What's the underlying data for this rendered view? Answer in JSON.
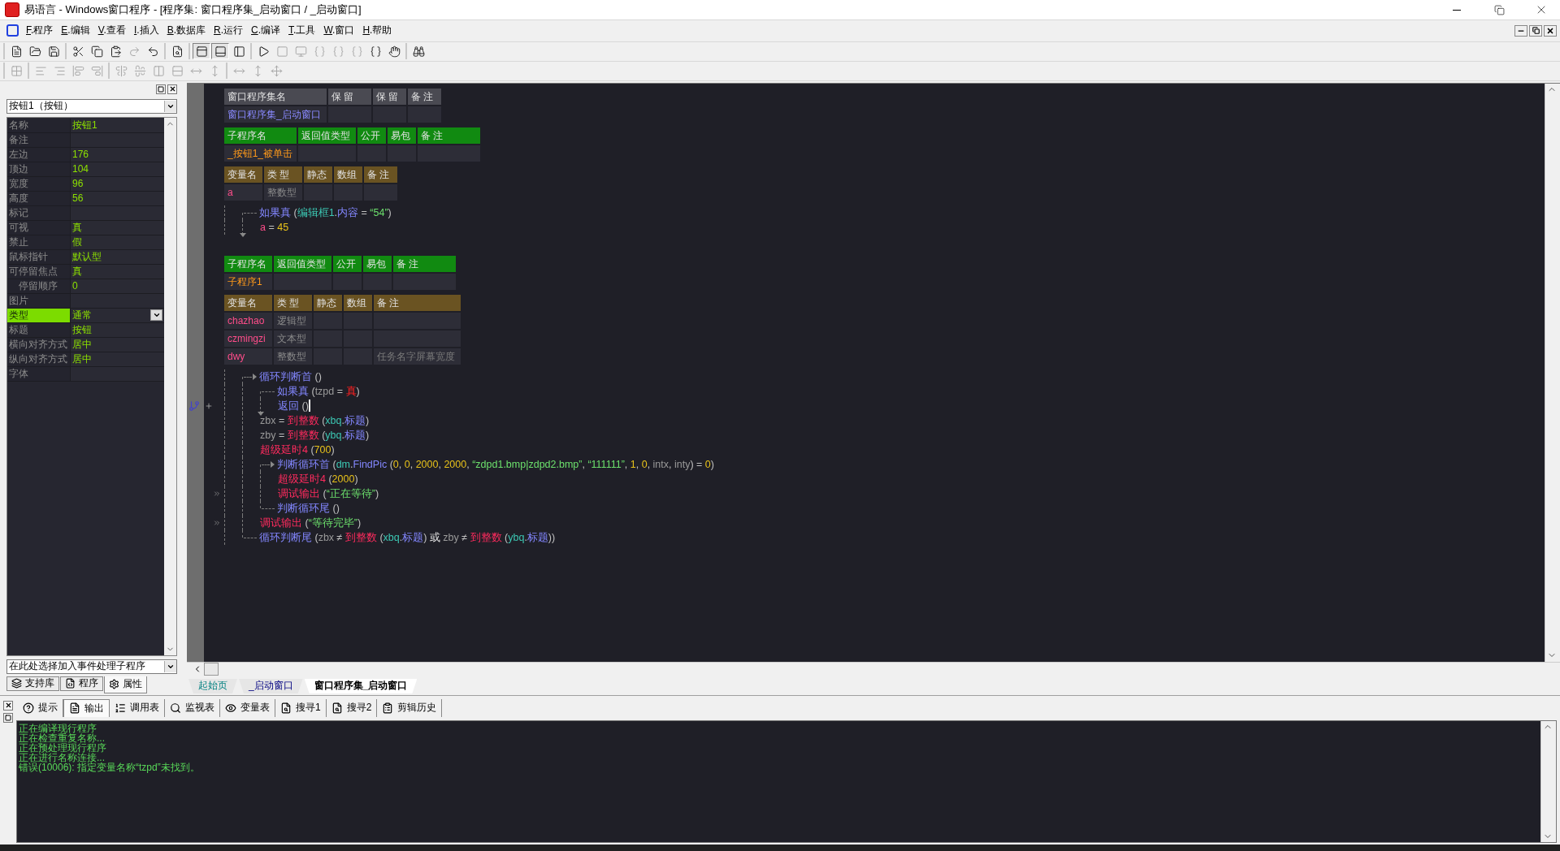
{
  "window": {
    "title": "易语言 - Windows窗口程序 - [程序集: 窗口程序集_启动窗口 / _启动窗口]"
  },
  "menu": [
    "F.程序",
    "E.编辑",
    "V.查看",
    "I.插入",
    "B.数据库",
    "R.运行",
    "C.编译",
    "T.工具",
    "W.窗口",
    "H.帮助"
  ],
  "toolbars": [
    [
      {
        "kind": "new",
        "disabled": false,
        "pressed": false
      },
      {
        "kind": "open",
        "disabled": false,
        "pressed": false
      },
      {
        "kind": "save",
        "disabled": false,
        "pressed": false
      },
      {
        "kind": "sep"
      },
      {
        "kind": "cut",
        "disabled": false,
        "pressed": false
      },
      {
        "kind": "copy",
        "disabled": false,
        "pressed": false
      },
      {
        "kind": "paste",
        "disabled": false,
        "pressed": false
      },
      {
        "kind": "redo",
        "disabled": true,
        "pressed": false
      },
      {
        "kind": "undo",
        "disabled": false,
        "pressed": false
      },
      {
        "kind": "sep"
      },
      {
        "kind": "find",
        "disabled": false,
        "pressed": false
      },
      {
        "kind": "sep"
      },
      {
        "kind": "layouttop",
        "disabled": false,
        "pressed": true
      },
      {
        "kind": "layoutbottom",
        "disabled": false,
        "pressed": true
      },
      {
        "kind": "layoutleft",
        "disabled": false,
        "pressed": false
      },
      {
        "kind": "sep"
      },
      {
        "kind": "run",
        "disabled": false,
        "pressed": false
      },
      {
        "kind": "stop",
        "disabled": true,
        "pressed": false
      },
      {
        "kind": "monitor",
        "disabled": true,
        "pressed": false
      },
      {
        "kind": "stepin",
        "disabled": true,
        "pressed": false
      },
      {
        "kind": "stepover",
        "disabled": true,
        "pressed": false
      },
      {
        "kind": "stepout",
        "disabled": true,
        "pressed": false
      },
      {
        "kind": "runto",
        "disabled": false,
        "pressed": false
      },
      {
        "kind": "hand",
        "disabled": false,
        "pressed": false
      },
      {
        "kind": "sep"
      },
      {
        "kind": "helpfind",
        "disabled": false,
        "pressed": false
      }
    ],
    [
      {
        "kind": "grid",
        "disabled": true,
        "pressed": false
      },
      {
        "kind": "sep"
      },
      {
        "kind": "alignleft",
        "disabled": true,
        "pressed": false
      },
      {
        "kind": "alignright",
        "disabled": true,
        "pressed": false
      },
      {
        "kind": "aligntop",
        "disabled": true,
        "pressed": false
      },
      {
        "kind": "alignbottom",
        "disabled": true,
        "pressed": false
      },
      {
        "kind": "sep"
      },
      {
        "kind": "centerh",
        "disabled": true,
        "pressed": false
      },
      {
        "kind": "centerv",
        "disabled": true,
        "pressed": false
      },
      {
        "kind": "spaceh",
        "disabled": true,
        "pressed": false
      },
      {
        "kind": "spacev",
        "disabled": true,
        "pressed": false
      },
      {
        "kind": "sizeh",
        "disabled": true,
        "pressed": false
      },
      {
        "kind": "sizev",
        "disabled": true,
        "pressed": false
      },
      {
        "kind": "sep"
      },
      {
        "kind": "widthsame",
        "disabled": true,
        "pressed": false
      },
      {
        "kind": "heightsame",
        "disabled": true,
        "pressed": false
      },
      {
        "kind": "move",
        "disabled": true,
        "pressed": false
      }
    ]
  ],
  "object_selector": {
    "value": "按钮1（按钮）"
  },
  "properties": [
    {
      "label": "名称",
      "value": "按钮1",
      "selected": false
    },
    {
      "label": "备注",
      "selected": false
    },
    {
      "label": "左边",
      "value": "176",
      "selected": false
    },
    {
      "label": "顶边",
      "value": "104",
      "selected": false
    },
    {
      "label": "宽度",
      "value": "96",
      "selected": false
    },
    {
      "label": "高度",
      "value": "56",
      "selected": false
    },
    {
      "label": "标记",
      "selected": false
    },
    {
      "label": "可视",
      "value": "真",
      "selected": false
    },
    {
      "label": "禁止",
      "value": "假",
      "selected": false
    },
    {
      "label": "鼠标指针",
      "value": "默认型",
      "selected": false
    },
    {
      "label": "可停留焦点",
      "value": "真",
      "selected": false,
      "children": [
        {
          "label": "停留顺序",
          "value": "0",
          "selected": false
        }
      ]
    },
    {
      "label": "图片",
      "selected": false
    },
    {
      "label": "类型",
      "value": "通常",
      "selected": true
    },
    {
      "label": "标题",
      "value": "按钮",
      "selected": false
    },
    {
      "label": "横向对齐方式",
      "value": "居中",
      "selected": false
    },
    {
      "label": "纵向对齐方式",
      "value": "居中",
      "selected": false
    },
    {
      "label": "字体",
      "selected": false
    }
  ],
  "event_selector": {
    "value": "在此处选择加入事件处理子程序"
  },
  "panel_tabs": [
    {
      "label": "支持库",
      "kind": "library",
      "selected": false
    },
    {
      "label": "程序",
      "kind": "program",
      "selected": false
    },
    {
      "label": "属性",
      "kind": "property",
      "selected": true
    }
  ],
  "editor": {
    "program_set": {
      "columns": [
        "窗口程序集名",
        "保 留",
        "保 留",
        "备 注"
      ],
      "name": "窗口程序集_启动窗口"
    },
    "subroutines": [
      {
        "columns": [
          "子程序名",
          "返回值类型",
          "公开",
          "易包",
          "备 注"
        ],
        "name": "_按钮1_被单击",
        "var_columns": [
          "变量名",
          "类 型",
          "静态",
          "数组",
          "备 注"
        ],
        "variables": [
          {
            "name": "a",
            "type": "整数型"
          }
        ],
        "code": [
          {
            "kind": "if",
            "tokens": [
              {
                "kind": "cmd",
                "text": "如果真"
              },
              {
                "kind": "plain",
                "text": " ("
              },
              {
                "kind": "obj",
                "text": "编辑框1"
              },
              {
                "kind": "plain",
                "text": "."
              },
              {
                "kind": "prop",
                "text": "内容"
              },
              {
                "kind": "plain",
                "text": " = "
              },
              {
                "kind": "str",
                "text": "“54”"
              },
              {
                "kind": "plain",
                "text": ")"
              }
            ],
            "children": [
              {
                "kind": "line",
                "tokens": [
                  {
                    "kind": "local",
                    "text": "a"
                  },
                  {
                    "kind": "plain",
                    "text": " = "
                  },
                  {
                    "kind": "num",
                    "text": "45"
                  }
                ]
              }
            ]
          }
        ]
      },
      {
        "columns": [
          "子程序名",
          "返回值类型",
          "公开",
          "易包",
          "备 注"
        ],
        "name": "子程序1",
        "var_columns": [
          "变量名",
          "类 型",
          "静态",
          "数组",
          "备 注"
        ],
        "variables": [
          {
            "name": "chazhao",
            "type": "逻辑型"
          },
          {
            "name": "czmingzi",
            "type": "文本型"
          },
          {
            "name": "dwy",
            "type": "整数型",
            "remark": "任务名字屏幕宽度"
          }
        ],
        "code": [
          {
            "kind": "loop",
            "tokens": [
              {
                "kind": "cmd",
                "text": "循环判断首"
              },
              {
                "kind": "plain",
                "text": " ()"
              }
            ],
            "children": [
              {
                "kind": "if",
                "tokens": [
                  {
                    "kind": "cmd",
                    "text": "如果真"
                  },
                  {
                    "kind": "plain",
                    "text": " ("
                  },
                  {
                    "kind": "var",
                    "text": "tzpd"
                  },
                  {
                    "kind": "plain",
                    "text": " = "
                  },
                  {
                    "kind": "lit",
                    "text": "真"
                  },
                  {
                    "kind": "plain",
                    "text": ")"
                  }
                ],
                "children": [
                  {
                    "kind": "line",
                    "flowchart": true,
                    "cursor": true,
                    "tokens": [
                      {
                        "kind": "cmd",
                        "text": "返回"
                      },
                      {
                        "kind": "plain",
                        "text": " ()"
                      }
                    ]
                  }
                ]
              },
              {
                "kind": "line",
                "tokens": [
                  {
                    "kind": "var",
                    "text": "zbx"
                  },
                  {
                    "kind": "plain",
                    "text": " = "
                  },
                  {
                    "kind": "fn",
                    "text": "到整数"
                  },
                  {
                    "kind": "plain",
                    "text": " ("
                  },
                  {
                    "kind": "obj",
                    "text": "xbq"
                  },
                  {
                    "kind": "plain",
                    "text": "."
                  },
                  {
                    "kind": "prop",
                    "text": "标题"
                  },
                  {
                    "kind": "plain",
                    "text": ")"
                  }
                ]
              },
              {
                "kind": "line",
                "tokens": [
                  {
                    "kind": "var",
                    "text": "zby"
                  },
                  {
                    "kind": "plain",
                    "text": " = "
                  },
                  {
                    "kind": "fn",
                    "text": "到整数"
                  },
                  {
                    "kind": "plain",
                    "text": " ("
                  },
                  {
                    "kind": "obj",
                    "text": "ybq"
                  },
                  {
                    "kind": "plain",
                    "text": "."
                  },
                  {
                    "kind": "prop",
                    "text": "标题"
                  },
                  {
                    "kind": "plain",
                    "text": ")"
                  }
                ]
              },
              {
                "kind": "line",
                "tokens": [
                  {
                    "kind": "fn",
                    "text": "超级延时4"
                  },
                  {
                    "kind": "plain",
                    "text": " ("
                  },
                  {
                    "kind": "num",
                    "text": "700"
                  },
                  {
                    "kind": "plain",
                    "text": ")"
                  }
                ]
              },
              {
                "kind": "loop",
                "tokens": [
                  {
                    "kind": "cmd",
                    "text": "判断循环首"
                  },
                  {
                    "kind": "plain",
                    "text": " ("
                  },
                  {
                    "kind": "obj",
                    "text": "dm"
                  },
                  {
                    "kind": "plain",
                    "text": "."
                  },
                  {
                    "kind": "prop",
                    "text": "FindPic"
                  },
                  {
                    "kind": "plain",
                    "text": " ("
                  },
                  {
                    "kind": "num",
                    "text": "0"
                  },
                  {
                    "kind": "plain",
                    "text": ", "
                  },
                  {
                    "kind": "num",
                    "text": "0"
                  },
                  {
                    "kind": "plain",
                    "text": ", "
                  },
                  {
                    "kind": "num",
                    "text": "2000"
                  },
                  {
                    "kind": "plain",
                    "text": ", "
                  },
                  {
                    "kind": "num",
                    "text": "2000"
                  },
                  {
                    "kind": "plain",
                    "text": ", "
                  },
                  {
                    "kind": "str",
                    "text": "“zdpd1.bmp|zdpd2.bmp”"
                  },
                  {
                    "kind": "plain",
                    "text": ", "
                  },
                  {
                    "kind": "str",
                    "text": "“111111”"
                  },
                  {
                    "kind": "plain",
                    "text": ", "
                  },
                  {
                    "kind": "num",
                    "text": "1"
                  },
                  {
                    "kind": "plain",
                    "text": ", "
                  },
                  {
                    "kind": "num",
                    "text": "0"
                  },
                  {
                    "kind": "plain",
                    "text": ", "
                  },
                  {
                    "kind": "var",
                    "text": "intx"
                  },
                  {
                    "kind": "plain",
                    "text": ", "
                  },
                  {
                    "kind": "var",
                    "text": "inty"
                  },
                  {
                    "kind": "plain",
                    "text": ") = "
                  },
                  {
                    "kind": "num",
                    "text": "0"
                  },
                  {
                    "kind": "plain",
                    "text": ")"
                  }
                ],
                "children": [
                  {
                    "kind": "line",
                    "tokens": [
                      {
                        "kind": "fn",
                        "text": "超级延时4"
                      },
                      {
                        "kind": "plain",
                        "text": " ("
                      },
                      {
                        "kind": "num",
                        "text": "2000"
                      },
                      {
                        "kind": "plain",
                        "text": ")"
                      }
                    ]
                  },
                  {
                    "kind": "line",
                    "bookmark": true,
                    "tokens": [
                      {
                        "kind": "fn",
                        "text": "调试输出"
                      },
                      {
                        "kind": "plain",
                        "text": " ("
                      },
                      {
                        "kind": "str",
                        "text": "“正在等待”"
                      },
                      {
                        "kind": "plain",
                        "text": ")"
                      }
                    ]
                  }
                ],
                "end": [
                  {
                    "kind": "cmd",
                    "text": "判断循环尾"
                  },
                  {
                    "kind": "plain",
                    "text": " ()"
                  }
                ]
              },
              {
                "kind": "line",
                "bookmark": true,
                "tokens": [
                  {
                    "kind": "fn",
                    "text": "调试输出"
                  },
                  {
                    "kind": "plain",
                    "text": " ("
                  },
                  {
                    "kind": "str",
                    "text": "“等待完毕”"
                  },
                  {
                    "kind": "plain",
                    "text": ")"
                  }
                ]
              }
            ],
            "end": [
              {
                "kind": "cmd",
                "text": "循环判断尾"
              },
              {
                "kind": "plain",
                "text": " ("
              },
              {
                "kind": "var",
                "text": "zbx"
              },
              {
                "kind": "plain",
                "text": " ≠ "
              },
              {
                "kind": "fn",
                "text": "到整数"
              },
              {
                "kind": "plain",
                "text": " ("
              },
              {
                "kind": "obj",
                "text": "xbq"
              },
              {
                "kind": "plain",
                "text": "."
              },
              {
                "kind": "prop",
                "text": "标题"
              },
              {
                "kind": "plain",
                "text": ") "
              },
              {
                "kind": "op",
                "text": "或 "
              },
              {
                "kind": "var",
                "text": "zby"
              },
              {
                "kind": "plain",
                "text": " ≠ "
              },
              {
                "kind": "fn",
                "text": "到整数"
              },
              {
                "kind": "plain",
                "text": " ("
              },
              {
                "kind": "obj",
                "text": "ybq"
              },
              {
                "kind": "plain",
                "text": "."
              },
              {
                "kind": "prop",
                "text": "标题"
              },
              {
                "kind": "plain",
                "text": "))"
              }
            ]
          }
        ]
      }
    ]
  },
  "editor_tabs": [
    {
      "label": "起始页",
      "selected": false,
      "kind": "start"
    },
    {
      "label": "_启动窗口",
      "selected": false,
      "kind": "design"
    },
    {
      "label": "窗口程序集_启动窗口",
      "selected": true,
      "kind": "code"
    }
  ],
  "bottom_tabs": [
    {
      "label": "提示",
      "kind": "hint",
      "selected": false
    },
    {
      "label": "输出",
      "kind": "output",
      "selected": true
    },
    {
      "label": "调用表",
      "kind": "calls",
      "selected": false
    },
    {
      "label": "监视表",
      "kind": "watch",
      "selected": false
    },
    {
      "label": "变量表",
      "kind": "vars",
      "selected": false
    },
    {
      "label": "搜寻1",
      "kind": "search",
      "selected": false
    },
    {
      "label": "搜寻2",
      "kind": "search",
      "selected": false
    },
    {
      "label": "剪辑历史",
      "kind": "clips",
      "selected": false
    }
  ],
  "output": [
    "正在编译现行程序",
    "正在检查重复名称...",
    "正在预处理现行程序",
    "正在进行名称连接...",
    "错误(10006): 指定变量名称“tzpd”未找到。"
  ]
}
